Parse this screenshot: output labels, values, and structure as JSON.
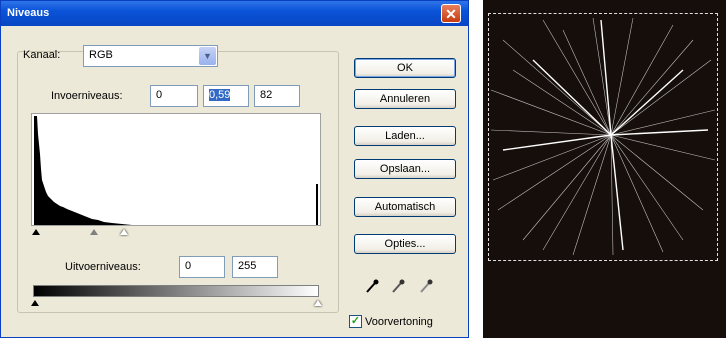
{
  "dialog": {
    "title": "Niveaus",
    "close_glyph": "✕",
    "channel_label": "Kanaal:",
    "channel_value": "RGB",
    "input_label": "Invoerniveaus:",
    "input_values": [
      "0",
      "0,59",
      "82"
    ],
    "output_label": "Uitvoerniveaus:",
    "output_values": [
      "0",
      "255"
    ],
    "buttons": [
      "OK",
      "Annuleren",
      "Laden...",
      "Opslaan...",
      "Automatisch",
      "Opties..."
    ],
    "preview_label": "Voorvertoning",
    "preview_checked": true,
    "eyedroppers": [
      "black-eyedropper-icon",
      "gray-eyedropper-icon",
      "white-eyedropper-icon"
    ]
  },
  "colors": {
    "titlebar": "#0a53d8",
    "dialog_bg": "#ece9d8",
    "selection": "#316ac5",
    "preview_bg": "#150e0b"
  }
}
